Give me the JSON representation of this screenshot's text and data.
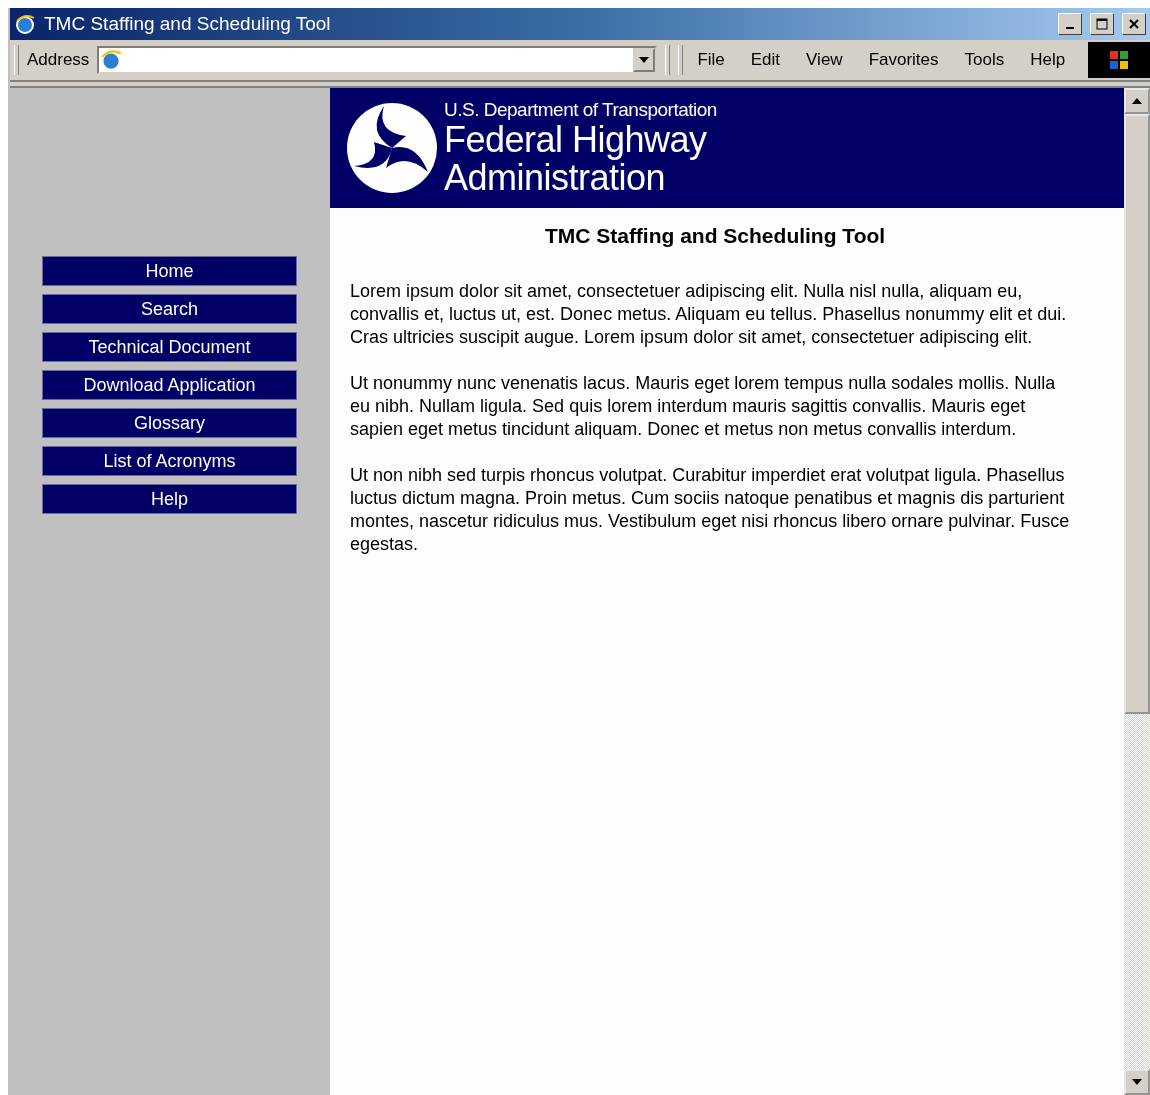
{
  "window": {
    "title": "TMC Staffing and Scheduling Tool",
    "controls": [
      {
        "kind": "minimize"
      },
      {
        "kind": "maximize"
      },
      {
        "kind": "close"
      }
    ]
  },
  "toolbar": {
    "address_label": "Address",
    "menu": [
      "File",
      "Edit",
      "View",
      "Favorites",
      "Tools",
      "Help"
    ]
  },
  "banner": {
    "department": "U.S. Department of Transportation",
    "agency_line_1": "Federal Highway",
    "agency_line_2": "Administration"
  },
  "nav": [
    "Home",
    "Search",
    "Technical Document",
    "Download Application",
    "Glossary",
    "List of Acronyms",
    "Help"
  ],
  "page": {
    "heading": "TMC Staffing and Scheduling Tool",
    "paragraphs": [
      "Lorem ipsum dolor sit amet, consectetuer adipiscing elit. Nulla nisl nulla, aliquam eu, convallis et, luctus ut, est. Donec metus. Aliquam eu tellus. Phasellus nonummy elit et dui. Cras ultricies suscipit augue. Lorem ipsum dolor sit amet, consectetuer adipiscing elit.",
      "Ut nonummy nunc venenatis lacus. Mauris eget lorem tempus nulla sodales mollis. Nulla eu nibh. Nullam ligula. Sed quis lorem interdum mauris sagittis convallis. Mauris eget sapien eget metus tincidunt aliquam. Donec et metus non metus convallis interdum.",
      "Ut non nibh sed turpis rhoncus volutpat. Curabitur imperdiet erat volutpat ligula. Phasellus luctus dictum magna. Proin metus. Cum sociis natoque penatibus et magnis dis parturient montes, nascetur ridiculus mus. Vestibulum eget nisi rhoncus libero ornare pulvinar. Fusce egestas."
    ]
  }
}
